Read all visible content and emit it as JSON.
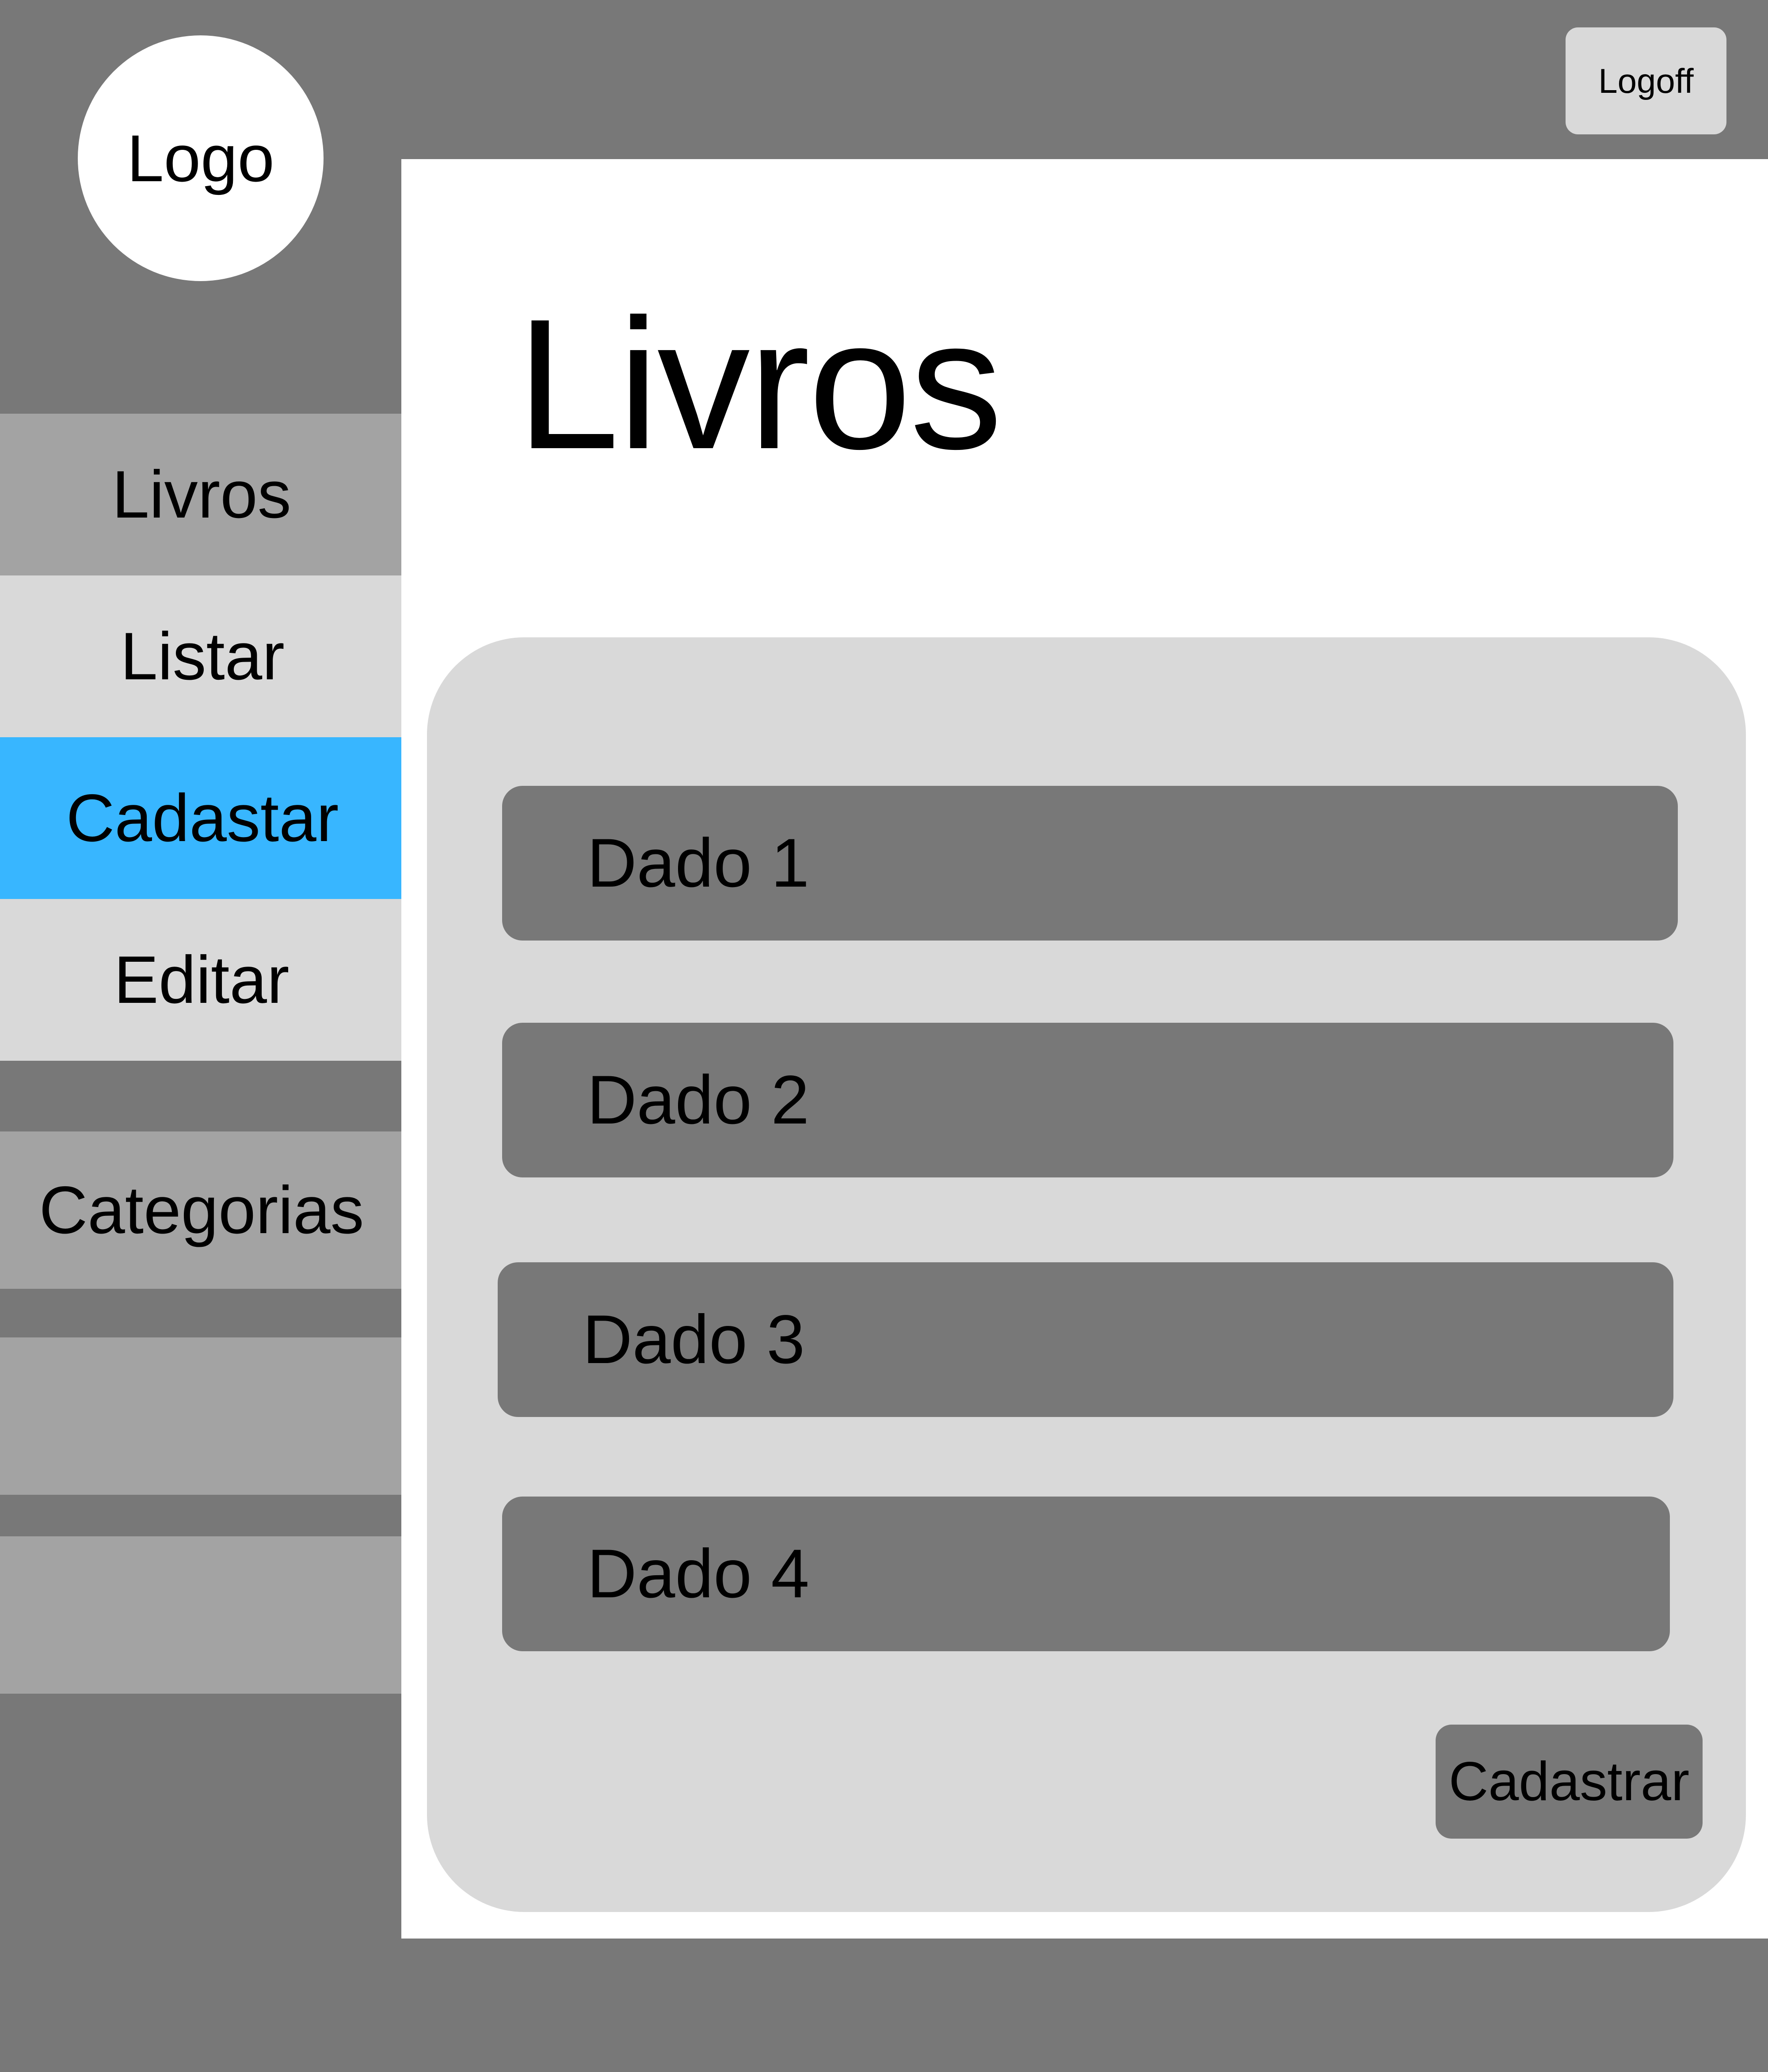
{
  "header": {
    "logo_text": "Logo",
    "logoff_label": "Logoff"
  },
  "sidebar": {
    "items": [
      {
        "label": "Livros",
        "state": "section"
      },
      {
        "label": "Listar",
        "state": "normal"
      },
      {
        "label": "Cadastar",
        "state": "active"
      },
      {
        "label": "Editar",
        "state": "normal"
      },
      {
        "label": "Categorias",
        "state": "section"
      },
      {
        "label": "",
        "state": "section"
      },
      {
        "label": "",
        "state": "section"
      }
    ]
  },
  "main": {
    "title": "Livros",
    "fields": [
      {
        "label": "Dado 1"
      },
      {
        "label": "Dado 2"
      },
      {
        "label": "Dado 3"
      },
      {
        "label": "Dado 4"
      }
    ],
    "submit_label": "Cadastrar"
  },
  "colors": {
    "background": "#787878",
    "sidebar_section": "#a3a3a3",
    "sidebar_item": "#d9d9d9",
    "sidebar_active": "#38b6ff",
    "content_bg": "#ffffff",
    "card_bg": "#d9d9d9",
    "field_bg": "#787878"
  }
}
